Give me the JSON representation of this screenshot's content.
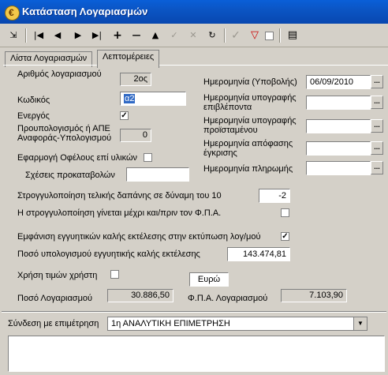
{
  "window": {
    "title": "Κατάσταση Λογαριασμών"
  },
  "toolbar": {
    "icons": [
      "exit-icon",
      "first-record-icon",
      "prior-record-icon",
      "next-record-icon",
      "last-record-icon",
      "insert-icon",
      "delete-icon",
      "edit-icon",
      "post-icon",
      "cancel-icon",
      "refresh-icon",
      "approve-icon",
      "filter-icon",
      "checkbox",
      "print-icon"
    ],
    "glyphs": {
      "exit": "⇲",
      "first": "|◀",
      "prior": "◀",
      "next": "▶",
      "last": "▶|",
      "insert": "+",
      "delete": "—",
      "edit": "▲",
      "post": "✓",
      "cancel": "✕",
      "refresh": "↻",
      "approve": "✓",
      "filter": "▽",
      "print": "▤"
    }
  },
  "tabs": [
    {
      "label": "Λίστα Λογαριασμών"
    },
    {
      "label": "Λεπτομέρειες"
    }
  ],
  "left": {
    "arithmos_label": "Αριθμός λογαριασμού",
    "arithmos_value": "2ος",
    "kodikos_label": "Κωδικός",
    "kodikos_value": "α2",
    "energos_label": "Ενεργός",
    "energos_checked": "✓",
    "proupologismos_label": "Προυπολογισμός ή ΑΠΕ Αναφοράς-Υπολογισμού",
    "proupologismos_value": "0",
    "efarmogi_label": "Εφαρμογή Οφέλους επί υλικών",
    "sxeseis_label": "Σχέσεις προκαταβολών",
    "sxeseis_value": ""
  },
  "right": {
    "date_submit_label": "Ημερομηνία (Υποβολής)",
    "date_submit_value": "06/09/2010",
    "date_supervisor_label": "Ημερομηνία υπογραφής επιβλέποντα",
    "date_head_label": "Ημερομηνία υπογραφής προϊσταμένου",
    "date_approval_label": "Ημερομηνία απόφασης έγκρισης",
    "date_payment_label": "Ημερομηνία πληρωμής",
    "ellipsis": "..."
  },
  "rounding": {
    "label": "Στρογγυλοποίηση τελικής δαπάνης σε δύναμη του 10",
    "value": "-2",
    "before_vat_label": "Η στρογγυλοποίηση γίνεται μέχρι και/πριν τον Φ.Π.Α."
  },
  "guarantees": {
    "show_label": "Εμφάνιση εγγυητικών καλής εκτέλεσης στην εκτύπωση λογ/μού",
    "show_checked": "✓",
    "amount_label": "Ποσό υπολογισμού εγγυητικής καλής εκτέλεσης",
    "amount_value": "143.474,81"
  },
  "user_prices": {
    "label": "Χρήση τιμών χρήστη",
    "currency": "Ευρώ"
  },
  "totals": {
    "amount_label": "Ποσό Λογαριασμού",
    "amount_value": "30.886,50",
    "vat_label": "Φ.Π.Α. Λογαριασμού",
    "vat_value": "7.103,90"
  },
  "link": {
    "label": "Σύνδεση με επιμέτρηση",
    "value": "1η ΑΝΑΛΥΤΙΚΗ ΕΠΙΜΕΤΡΗΣΗ",
    "dropdown_glyph": "▼"
  },
  "notes": {
    "value": ""
  }
}
